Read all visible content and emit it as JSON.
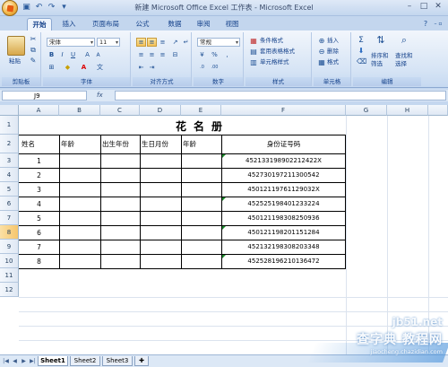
{
  "window": {
    "title": "新建 Microsoft Office Excel 工作表 - Microsoft Excel"
  },
  "ribbon_tabs": [
    "开始",
    "插入",
    "页面布局",
    "公式",
    "数据",
    "审阅",
    "视图"
  ],
  "ribbon": {
    "paste_label": "粘贴",
    "font_name": "宋体",
    "font_size": "11",
    "number_format": "常规",
    "cond_format": "条件格式",
    "table_format": "套用表格格式",
    "cell_style": "单元格样式",
    "insert": "插入",
    "delete": "删除",
    "format": "格式",
    "sort_filter": "排序和\n筛选",
    "find_select": "查找和\n选择",
    "groups": [
      "剪贴板",
      "字体",
      "对齐方式",
      "数字",
      "样式",
      "单元格",
      "编辑"
    ]
  },
  "formula_bar": {
    "name_box": "J9",
    "fx": "fx",
    "value": ""
  },
  "columns": [
    "A",
    "B",
    "C",
    "D",
    "E",
    "F",
    "G",
    "H"
  ],
  "rows": [
    "1",
    "2",
    "3",
    "4",
    "5",
    "6",
    "7",
    "8",
    "9",
    "10",
    "11",
    "12"
  ],
  "selected_row": "9",
  "sheet": {
    "title": "花名册",
    "headers": [
      "姓名",
      "年龄",
      "出生年份",
      "生日月份",
      "年龄",
      "身份证号码"
    ],
    "records": [
      {
        "no": "1",
        "id": "452133198902212422X"
      },
      {
        "no": "2",
        "id": "452730197211300542"
      },
      {
        "no": "3",
        "id": "45012119761129032X"
      },
      {
        "no": "4",
        "id": "452525198401233224"
      },
      {
        "no": "5",
        "id": "450121198308250936"
      },
      {
        "no": "6",
        "id": "450121198201151284"
      },
      {
        "no": "7",
        "id": "452132198308203348"
      },
      {
        "no": "8",
        "id": "452528196210136472"
      }
    ]
  },
  "sheet_tabs": [
    "Sheet1",
    "Sheet2",
    "Sheet3"
  ],
  "watermark": {
    "line1": "jb51.net",
    "line2": "查字典 教程网",
    "line3": "jiaocheng.chazidian.com"
  }
}
